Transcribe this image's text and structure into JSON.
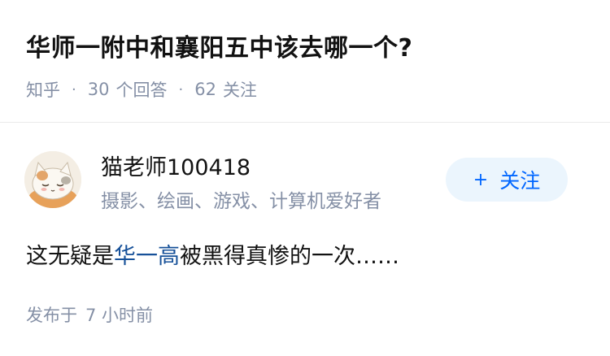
{
  "question": {
    "title": "华师一附中和襄阳五中该去哪一个?",
    "source": "知乎",
    "answer_count": "30",
    "answer_unit": "个回答",
    "follower_count": "62",
    "follower_unit": "关注"
  },
  "author": {
    "name": "猫老师100418",
    "bio": "摄影、绘画、游戏、计算机爱好者",
    "avatar_icon": "cat-avatar-icon",
    "follow_plus": "+",
    "follow_label": "关注"
  },
  "answer": {
    "text_before": "这无疑是",
    "link_text": "华一高",
    "text_after": "被黑得真惨的一次……"
  },
  "publish": {
    "prefix": "发布于",
    "time": "7 小时前"
  },
  "colors": {
    "accent": "#0066ff",
    "link": "#175199",
    "muted": "#8590a6",
    "button_bg": "#ebf5fd"
  }
}
